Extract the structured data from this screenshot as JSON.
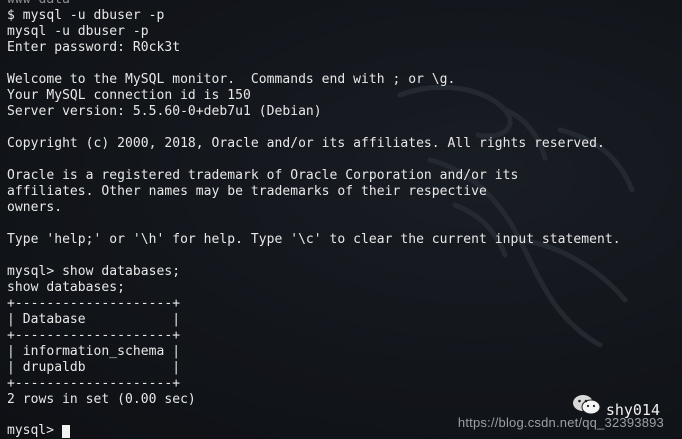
{
  "terminal": {
    "lines": [
      "www-data",
      "$ mysql -u dbuser -p",
      "mysql -u dbuser -p",
      "Enter password: R0ck3t",
      "",
      "Welcome to the MySQL monitor.  Commands end with ; or \\g.",
      "Your MySQL connection id is 150",
      "Server version: 5.5.60-0+deb7u1 (Debian)",
      "",
      "Copyright (c) 2000, 2018, Oracle and/or its affiliates. All rights reserved.",
      "",
      "Oracle is a registered trademark of Oracle Corporation and/or its",
      "affiliates. Other names may be trademarks of their respective",
      "owners.",
      "",
      "Type 'help;' or '\\h' for help. Type '\\c' to clear the current input statement.",
      "",
      "mysql> show databases;",
      "show databases;",
      "+--------------------+",
      "| Database           |",
      "+--------------------+",
      "| information_schema |",
      "| drupaldb           |",
      "+--------------------+",
      "2 rows in set (0.00 sec)",
      ""
    ],
    "prompt": "mysql>"
  },
  "watermark": {
    "url": "https://blog.csdn.net/qq_32393893",
    "author": "shy014",
    "logo_icon": "wechat-icon"
  }
}
